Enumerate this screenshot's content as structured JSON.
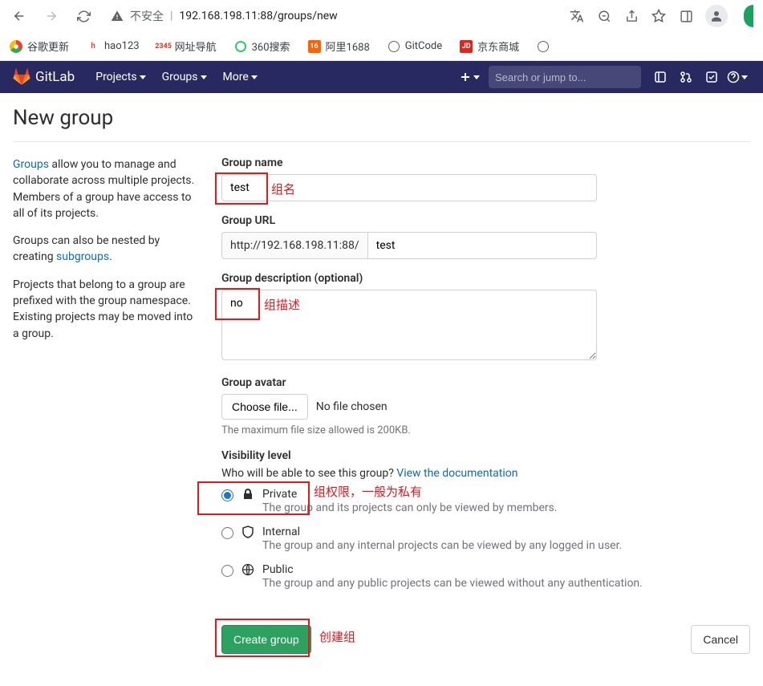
{
  "browser": {
    "url_prefix": "不安全",
    "url": "192.168.198.11:88/groups/new"
  },
  "bookmarks": [
    {
      "label": "谷歌更新"
    },
    {
      "label": "hao123"
    },
    {
      "label": "网址导航"
    },
    {
      "label": "360搜索"
    },
    {
      "label": "阿里1688"
    },
    {
      "label": "GitCode"
    },
    {
      "label": "京东商城"
    }
  ],
  "navbar": {
    "brand": "GitLab",
    "projects": "Projects",
    "groups": "Groups",
    "more": "More",
    "search_placeholder": "Search or jump to..."
  },
  "page": {
    "title": "New group"
  },
  "sidebar": {
    "p1_link": "Groups",
    "p1": " allow you to manage and collaborate across multiple projects. Members of a group have access to all of its projects.",
    "p2a": "Groups can also be nested by creating ",
    "p2_link": "subgroups",
    "p2b": ".",
    "p3": "Projects that belong to a group are prefixed with the group namespace. Existing projects may be moved into a group."
  },
  "form": {
    "name_label": "Group name",
    "name_value": "test",
    "url_label": "Group URL",
    "url_prefix": "http://192.168.198.11:88/",
    "url_value": "test",
    "desc_label": "Group description (optional)",
    "desc_value": "no",
    "avatar_label": "Group avatar",
    "avatar_button": "Choose file...",
    "avatar_nofile": "No file chosen",
    "avatar_help": "The maximum file size allowed is 200KB.",
    "vis_label": "Visibility level",
    "vis_sub": "Who will be able to see this group? ",
    "vis_doc": "View the documentation",
    "private_title": "Private",
    "private_desc": "The group and its projects can only be viewed by members.",
    "internal_title": "Internal",
    "internal_desc": "The group and any internal projects can be viewed by any logged in user.",
    "public_title": "Public",
    "public_desc": "The group and any public projects can be viewed without any authentication.",
    "submit": "Create group",
    "cancel": "Cancel"
  },
  "annotations": {
    "name": "组名",
    "desc": "组描述",
    "vis": "组权限，一般为私有",
    "create": "创建组"
  }
}
